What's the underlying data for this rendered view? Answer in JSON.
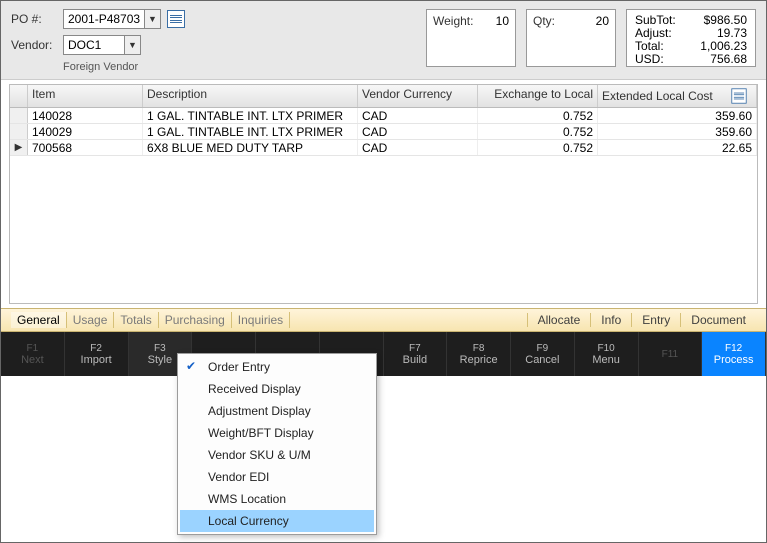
{
  "header": {
    "po_label": "PO #:",
    "po_value": "2001-P48703",
    "vendor_label": "Vendor:",
    "vendor_value": "DOC1",
    "foreign_vendor_text": "Foreign Vendor",
    "weight_label": "Weight:",
    "weight_value": "10",
    "qty_label": "Qty:",
    "qty_value": "20",
    "totals": {
      "subtot_label": "SubTot:",
      "subtot_value": "$986.50",
      "adjust_label": "Adjust:",
      "adjust_value": "19.73",
      "total_label": "Total:",
      "total_value": "1,006.23",
      "usd_label": "USD:",
      "usd_value": "756.68"
    }
  },
  "grid": {
    "columns": {
      "item": "Item",
      "description": "Description",
      "vendor_currency": "Vendor Currency",
      "exchange": "Exchange to Local",
      "extended": "Extended Local Cost"
    },
    "rows": [
      {
        "indicator": "",
        "item": "140028",
        "description": "1 GAL. TINTABLE INT. LTX PRIMER",
        "vcur": "CAD",
        "exch": "0.752",
        "ext": "359.60"
      },
      {
        "indicator": "",
        "item": "140029",
        "description": "1 GAL. TINTABLE INT. LTX PRIMER",
        "vcur": "CAD",
        "exch": "0.752",
        "ext": "359.60"
      },
      {
        "indicator": "▶",
        "item": "700568",
        "description": "6X8 BLUE MED DUTY TARP",
        "vcur": "CAD",
        "exch": "0.752",
        "ext": "22.65"
      }
    ]
  },
  "tabs": {
    "items": [
      "General",
      "Usage",
      "Totals",
      "Purchasing",
      "Inquiries"
    ],
    "actions": [
      "Allocate",
      "Info",
      "Entry",
      "Document"
    ]
  },
  "fkeys": [
    {
      "key": "F1",
      "label": "Next",
      "class": "disabled"
    },
    {
      "key": "F2",
      "label": "Import",
      "class": ""
    },
    {
      "key": "F3",
      "label": "Style",
      "class": "style"
    },
    {
      "key": "",
      "label": "",
      "class": ""
    },
    {
      "key": "",
      "label": "",
      "class": ""
    },
    {
      "key": "",
      "label": "",
      "class": ""
    },
    {
      "key": "F7",
      "label": "Build",
      "class": ""
    },
    {
      "key": "F8",
      "label": "Reprice",
      "class": ""
    },
    {
      "key": "F9",
      "label": "Cancel",
      "class": ""
    },
    {
      "key": "F10",
      "label": "Menu",
      "class": ""
    },
    {
      "key": "F11",
      "label": "",
      "class": "disabled"
    },
    {
      "key": "F12",
      "label": "Process",
      "class": "process"
    }
  ],
  "menu": {
    "items": [
      {
        "label": "Order Entry",
        "checked": true,
        "highlight": false
      },
      {
        "label": "Received Display",
        "checked": false,
        "highlight": false
      },
      {
        "label": "Adjustment Display",
        "checked": false,
        "highlight": false
      },
      {
        "label": "Weight/BFT Display",
        "checked": false,
        "highlight": false
      },
      {
        "label": "Vendor SKU & U/M",
        "checked": false,
        "highlight": false
      },
      {
        "label": "Vendor EDI",
        "checked": false,
        "highlight": false
      },
      {
        "label": "WMS Location",
        "checked": false,
        "highlight": false
      },
      {
        "label": "Local Currency",
        "checked": false,
        "highlight": true
      }
    ]
  }
}
